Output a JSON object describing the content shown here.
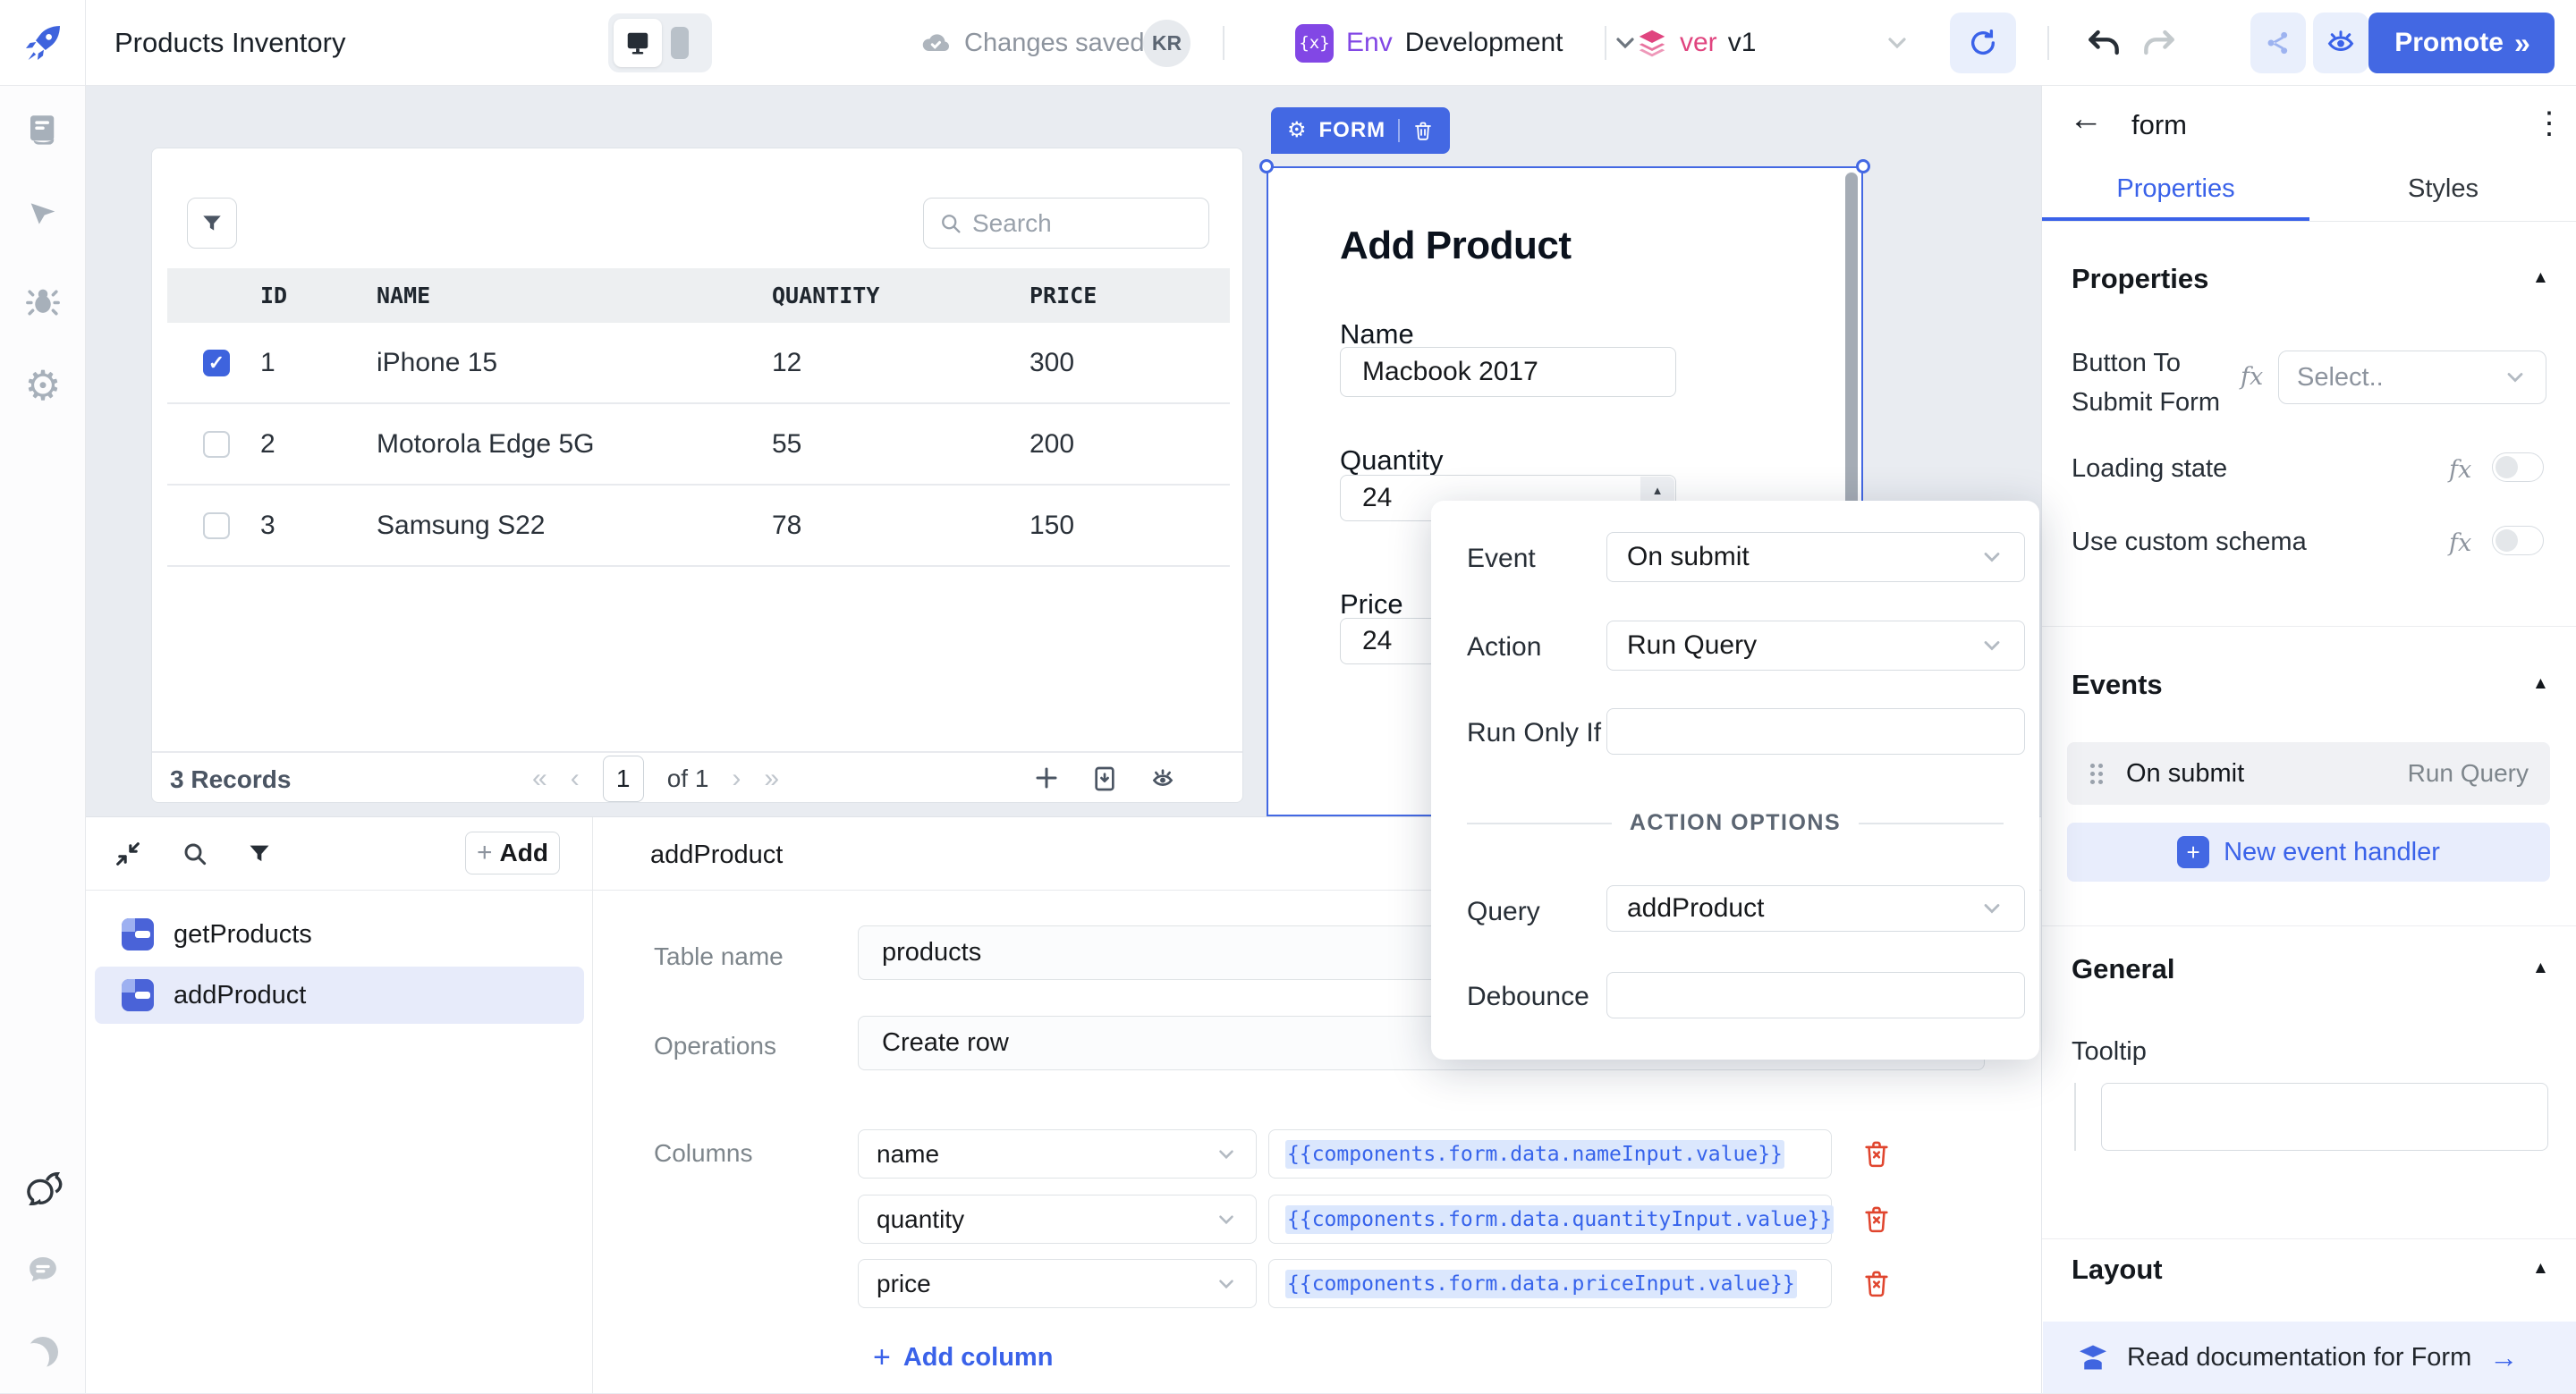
{
  "topbar": {
    "app_title": "Products Inventory",
    "status_text": "Changes saved",
    "avatar_initials": "KR",
    "env_icon_glyph": "{x}",
    "env_badge_label": "Env",
    "env_value": "Development",
    "version_badge_label": "ver",
    "version_value": "v1",
    "promote_label": "Promote",
    "promote_chevrons": "»"
  },
  "table_widget": {
    "search_placeholder": "Search",
    "columns": [
      "ID",
      "NAME",
      "QUANTITY",
      "PRICE"
    ],
    "rows": [
      {
        "checked": true,
        "id": "1",
        "name": "iPhone 15",
        "quantity": "12",
        "price": "300"
      },
      {
        "checked": false,
        "id": "2",
        "name": "Motorola Edge 5G",
        "quantity": "55",
        "price": "200"
      },
      {
        "checked": false,
        "id": "3",
        "name": "Samsung S22",
        "quantity": "78",
        "price": "150"
      }
    ],
    "records_label": "3 Records",
    "pagination": {
      "current_page": "1",
      "of_label": "of 1"
    }
  },
  "form_widget": {
    "widget_tag": "FORM",
    "title": "Add Product",
    "name_label": "Name",
    "name_value": "Macbook 2017",
    "quantity_label": "Quantity",
    "quantity_value": "24",
    "price_label": "Price",
    "price_value": "24"
  },
  "event_popover": {
    "event_label": "Event",
    "event_value": "On submit",
    "action_label": "Action",
    "action_value": "Run Query",
    "run_only_if_label": "Run Only If",
    "section_label": "ACTION OPTIONS",
    "query_label": "Query",
    "query_value": "addProduct",
    "debounce_label": "Debounce"
  },
  "query_panel": {
    "add_button_label": "Add",
    "query_list": [
      {
        "name": "getProducts",
        "selected": false
      },
      {
        "name": "addProduct",
        "selected": true
      }
    ],
    "editor_title": "addProduct",
    "table_name_label": "Table name",
    "table_name_value": "products",
    "operations_label": "Operations",
    "operations_value": "Create row",
    "columns_label": "Columns",
    "column_rows": [
      {
        "column": "name",
        "binding": "{{components.form.data.nameInput.value}}"
      },
      {
        "column": "quantity",
        "binding": "{{components.form.data.quantityInput.value}}"
      },
      {
        "column": "price",
        "binding": "{{components.form.data.priceInput.value}}"
      }
    ],
    "add_column_label": "Add column"
  },
  "inspector": {
    "widget_name": "form",
    "tab_properties": "Properties",
    "tab_styles": "Styles",
    "properties_heading": "Properties",
    "button_to_submit_label": "Button To Submit Form",
    "button_to_submit_value": "Select..",
    "fx_label": "fx",
    "loading_state_label": "Loading state",
    "use_custom_schema_label": "Use custom schema",
    "events_heading": "Events",
    "event_row_event": "On submit",
    "event_row_action": "Run Query",
    "new_event_handler_label": "New event handler",
    "general_heading": "General",
    "tooltip_label": "Tooltip",
    "layout_heading": "Layout",
    "docs_link_label": "Read documentation for Form"
  },
  "colors": {
    "accent_blue": "#4368E3",
    "env_purple": "#8247E5",
    "version_pink": "#E0447F",
    "delete_red": "#E0452E",
    "canvas_bg": "#E9ECF1",
    "selected_row_bg": "#E7EBFA"
  }
}
